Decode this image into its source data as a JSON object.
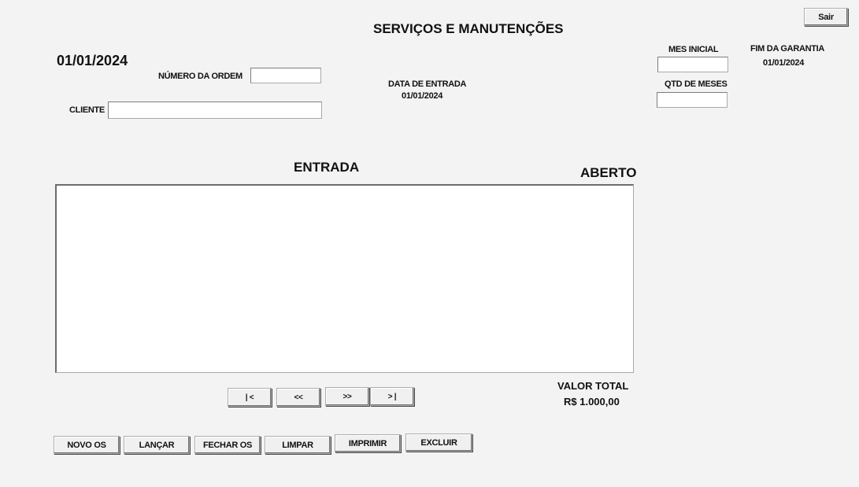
{
  "header": {
    "title": "SERVIÇOS E MANUTENÇÕES",
    "exit_label": "Sair",
    "current_date": "01/01/2024"
  },
  "form": {
    "order_number_label": "NÚMERO DA ORDEM",
    "order_number_value": "",
    "client_label": "CLIENTE",
    "client_value": "",
    "entry_date_label": "DATA DE ENTRADA",
    "entry_date_value": "01/01/2024",
    "start_month_label": "MES INICIAL",
    "start_month_value": "",
    "months_qty_label": "QTD DE MESES",
    "months_qty_value": "",
    "warranty_end_label": "FIM DA GARANTIA",
    "warranty_end_value": "01/01/2024"
  },
  "entry": {
    "heading": "ENTRADA",
    "status": "ABERTO",
    "items": []
  },
  "navigation": {
    "first_label": "| <",
    "prev_label": "<<",
    "next_label": ">>",
    "last_label": "> |"
  },
  "total": {
    "label": "VALOR TOTAL",
    "value": "R$ 1.000,00"
  },
  "actions": {
    "new_label": "NOVO OS",
    "launch_label": "LANÇAR",
    "close_label": "FECHAR OS",
    "clear_label": "LIMPAR",
    "print_label": "IMPRIMIR",
    "delete_label": "EXCLUIR"
  }
}
